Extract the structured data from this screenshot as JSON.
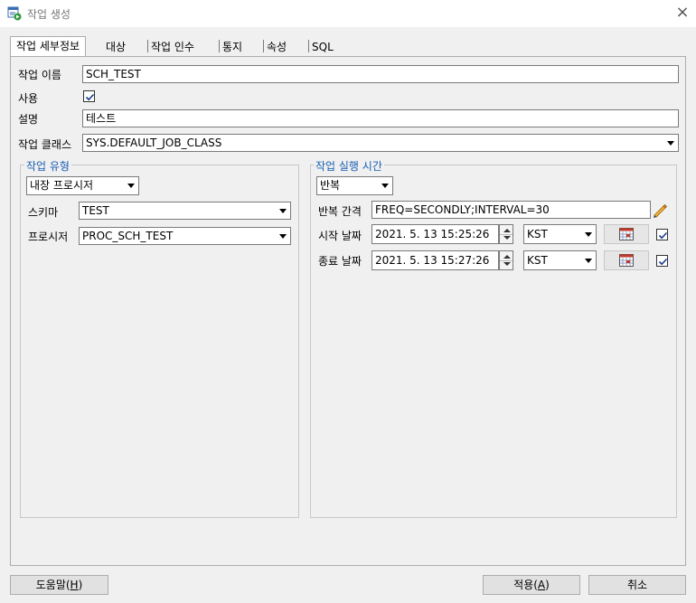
{
  "window": {
    "title": "작업 생성",
    "close_label": "×"
  },
  "tabs": [
    {
      "label": "작업 세부정보"
    },
    {
      "label": "대상"
    },
    {
      "label": "작업 인수"
    },
    {
      "label": "통지"
    },
    {
      "label": "속성"
    },
    {
      "label": "SQL"
    }
  ],
  "form": {
    "job_name_label": "작업 이름",
    "job_name_value": "SCH_TEST",
    "enabled_label": "사용",
    "enabled_checked": true,
    "description_label": "설명",
    "description_value": "테스트",
    "job_class_label": "작업 클래스",
    "job_class_value": "SYS.DEFAULT_JOB_CLASS"
  },
  "job_type": {
    "title": "작업 유형",
    "type_value": "내장 프로시저",
    "schema_label": "스키마",
    "schema_value": "TEST",
    "procedure_label": "프로시저",
    "procedure_value": "PROC_SCH_TEST"
  },
  "schedule": {
    "title": "작업 실행 시간",
    "mode_value": "반복",
    "interval_label": "반복 간격",
    "interval_value": "FREQ=SECONDLY;INTERVAL=30",
    "start_label": "시작 날짜",
    "start_value": "2021. 5. 13 15:25:26",
    "start_tz": "KST",
    "start_checked": true,
    "end_label": "종료 날짜",
    "end_value": "2021. 5. 13 15:27:26",
    "end_tz": "KST",
    "end_checked": true
  },
  "buttons": {
    "help_label": "도움말(",
    "help_key": "H",
    "apply_label": "적용(",
    "apply_key": "A",
    "close_paren": ")",
    "cancel_label": "취소"
  },
  "colors": {
    "group_title": "#1a5fb4",
    "background": "#f0f0f0",
    "pencil": "#d08a00"
  },
  "icons": [
    "app-window-icon",
    "close-icon",
    "checkmark-icon",
    "pencil-icon",
    "calendar-icon",
    "spin-up-icon",
    "spin-down-icon",
    "dropdown-arrow-icon"
  ]
}
